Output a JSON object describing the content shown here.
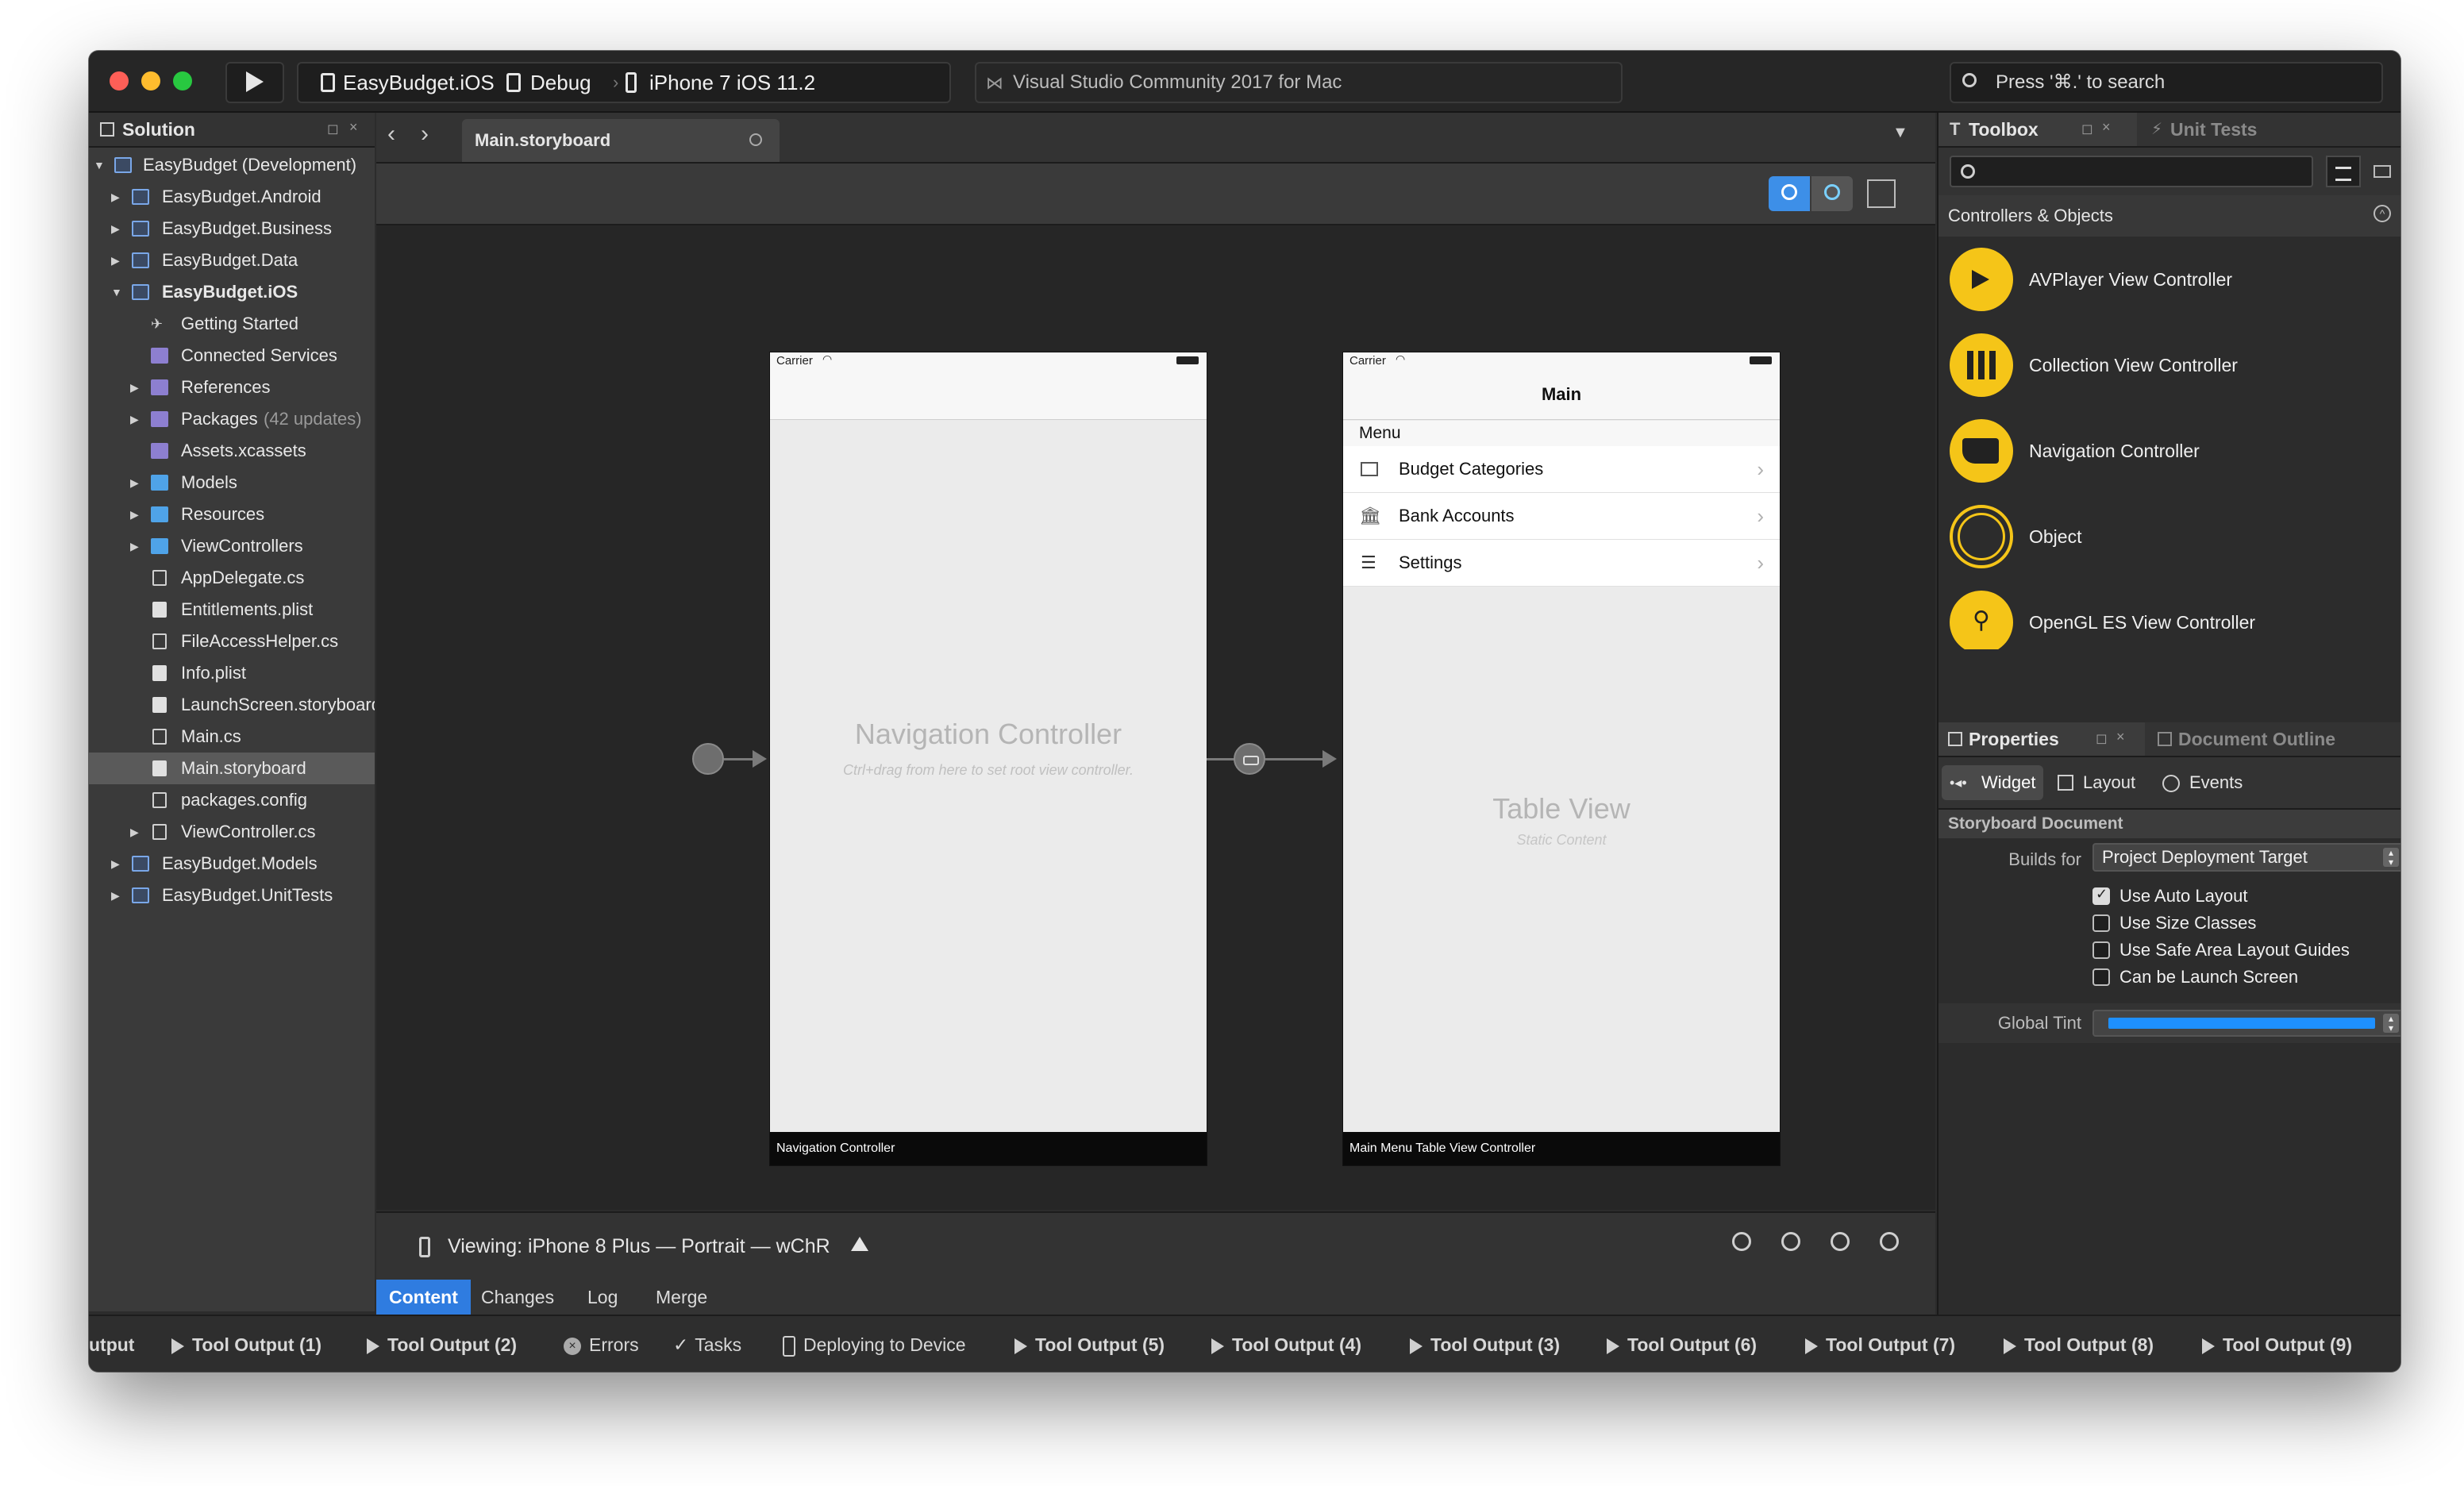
{
  "titlebar": {
    "project": "EasyBudget.iOS",
    "config": "Debug",
    "device": "iPhone 7 iOS 11.2",
    "app_title": "Visual Studio Community 2017 for Mac",
    "search_placeholder": "Press '⌘.' to search"
  },
  "solution": {
    "title": "Solution",
    "items": [
      {
        "label": "EasyBudget (Development)"
      },
      {
        "label": "EasyBudget.Android"
      },
      {
        "label": "EasyBudget.Business"
      },
      {
        "label": "EasyBudget.Data"
      },
      {
        "label": "EasyBudget.iOS"
      },
      {
        "label": "Getting Started"
      },
      {
        "label": "Connected Services"
      },
      {
        "label": "References"
      },
      {
        "label": "Packages",
        "extra": "(42 updates)"
      },
      {
        "label": "Assets.xcassets"
      },
      {
        "label": "Models"
      },
      {
        "label": "Resources"
      },
      {
        "label": "ViewControllers"
      },
      {
        "label": "AppDelegate.cs"
      },
      {
        "label": "Entitlements.plist"
      },
      {
        "label": "FileAccessHelper.cs"
      },
      {
        "label": "Info.plist"
      },
      {
        "label": "LaunchScreen.storyboard"
      },
      {
        "label": "Main.cs"
      },
      {
        "label": "Main.storyboard"
      },
      {
        "label": "packages.config"
      },
      {
        "label": "ViewController.cs"
      },
      {
        "label": "EasyBudget.Models"
      },
      {
        "label": "EasyBudget.UnitTests"
      }
    ]
  },
  "editor": {
    "tab_label": "Main.storyboard",
    "nav_controller": {
      "carrier": "Carrier",
      "title": "Navigation Controller",
      "hint": "Ctrl+drag from here to set root view controller.",
      "footer": "Navigation Controller"
    },
    "table_controller": {
      "carrier": "Carrier",
      "nav_title": "Main",
      "section": "Menu",
      "cells": [
        {
          "label": "Budget Categories"
        },
        {
          "label": "Bank Accounts"
        },
        {
          "label": "Settings"
        }
      ],
      "table_title": "Table View",
      "table_subtitle": "Static Content",
      "footer": "Main Menu Table View Controller"
    },
    "viewing": "Viewing: iPhone 8 Plus — Portrait — wChR",
    "view_tabs": [
      "Content",
      "Changes",
      "Log",
      "Merge"
    ]
  },
  "toolbox": {
    "title": "Toolbox",
    "unit_tests": "Unit Tests",
    "section": "Controllers & Objects",
    "items": [
      {
        "label": "AVPlayer View Controller"
      },
      {
        "label": "Collection View Controller"
      },
      {
        "label": "Navigation Controller"
      },
      {
        "label": "Object"
      },
      {
        "label": "OpenGL ES View Controller"
      }
    ]
  },
  "properties": {
    "title": "Properties",
    "outline": "Document Outline",
    "tabs": [
      "Widget",
      "Layout",
      "Events"
    ],
    "section": "Storyboard Document",
    "builds_for_label": "Builds for",
    "builds_for_value": "Project Deployment Target",
    "checks": [
      {
        "label": "Use Auto Layout",
        "checked": true
      },
      {
        "label": "Use Size Classes",
        "checked": false
      },
      {
        "label": "Use Safe Area Layout Guides",
        "checked": false
      },
      {
        "label": "Can be Launch Screen",
        "checked": false
      }
    ],
    "global_tint_label": "Global Tint",
    "tint_color": "#1e90ff"
  },
  "bottombar": {
    "items": [
      "utput",
      "Tool Output (1)",
      "Tool Output (2)",
      "Errors",
      "Tasks",
      "Deploying to Device",
      "Tool Output (5)",
      "Tool Output (4)",
      "Tool Output (3)",
      "Tool Output (6)",
      "Tool Output (7)",
      "Tool Output (8)",
      "Tool Output (9)"
    ]
  }
}
